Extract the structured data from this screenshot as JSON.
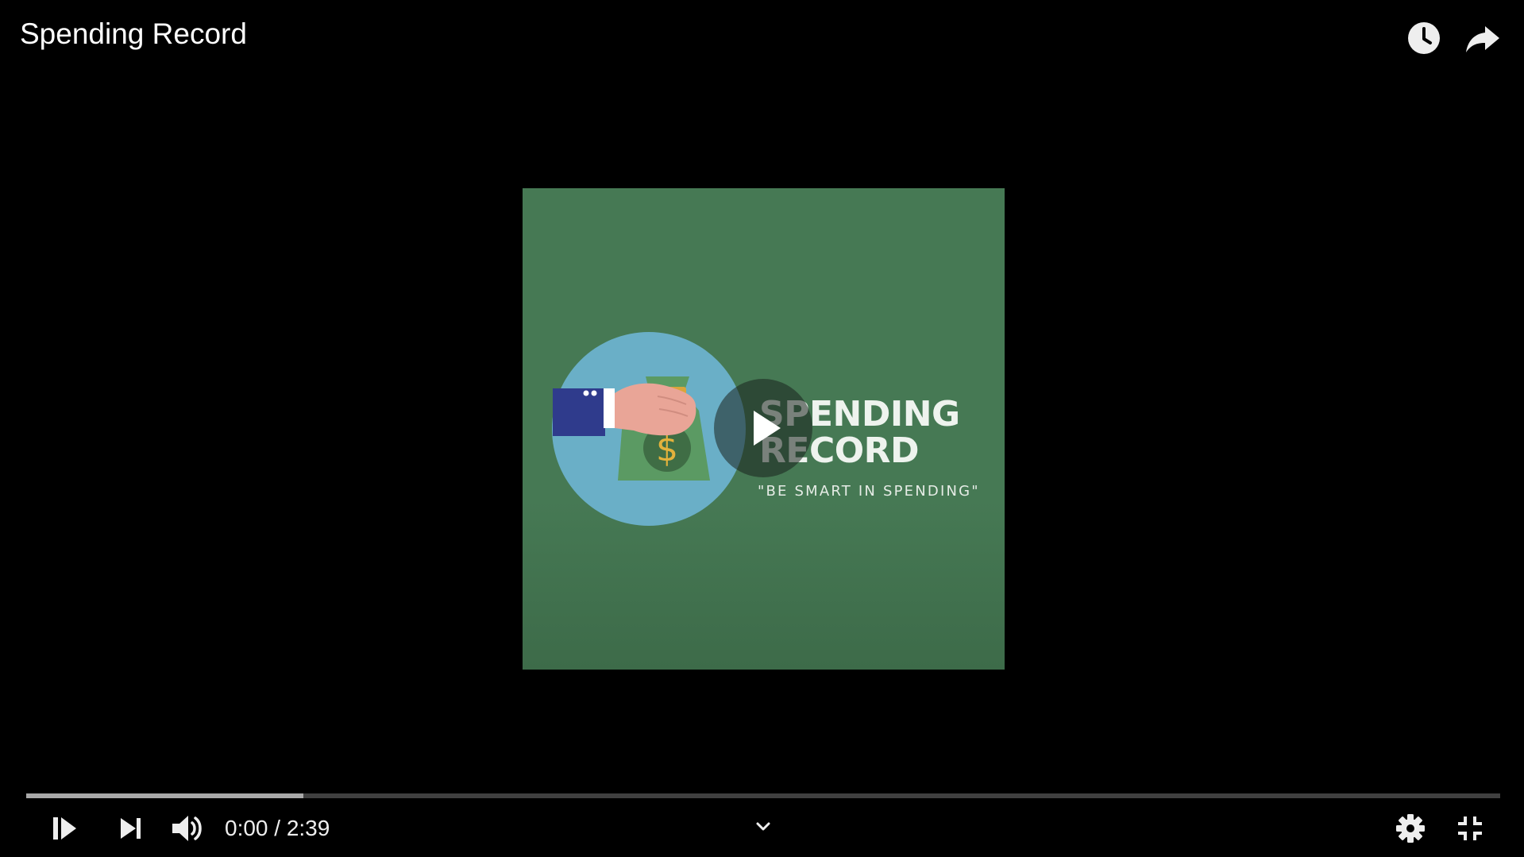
{
  "header": {
    "title": "Spending Record",
    "watch_later_icon": "clock-icon",
    "share_icon": "share-arrow-icon"
  },
  "thumbnail": {
    "title_line1": "SPENDING",
    "title_line2": "RECORD",
    "tagline": "\"BE SMART IN SPENDING\"",
    "background_color": "#467954",
    "circle_color": "#6aafc7",
    "bag_color": "#5b9a63",
    "sleeve_color": "#2f3b8c",
    "hand_color": "#e9a597",
    "dollar_color": "#e3b23c"
  },
  "big_play": {
    "icon": "play-icon"
  },
  "progress": {
    "played_fraction": 0.0,
    "buffered_fraction": 0.188
  },
  "controls": {
    "play_icon": "play-pause-icon",
    "next_icon": "skip-next-icon",
    "volume_icon": "volume-icon",
    "time_display": "0:00 / 2:39",
    "chevron_icon": "chevron-down-icon",
    "settings_icon": "gear-icon",
    "exit_fullscreen_icon": "exit-fullscreen-icon"
  }
}
